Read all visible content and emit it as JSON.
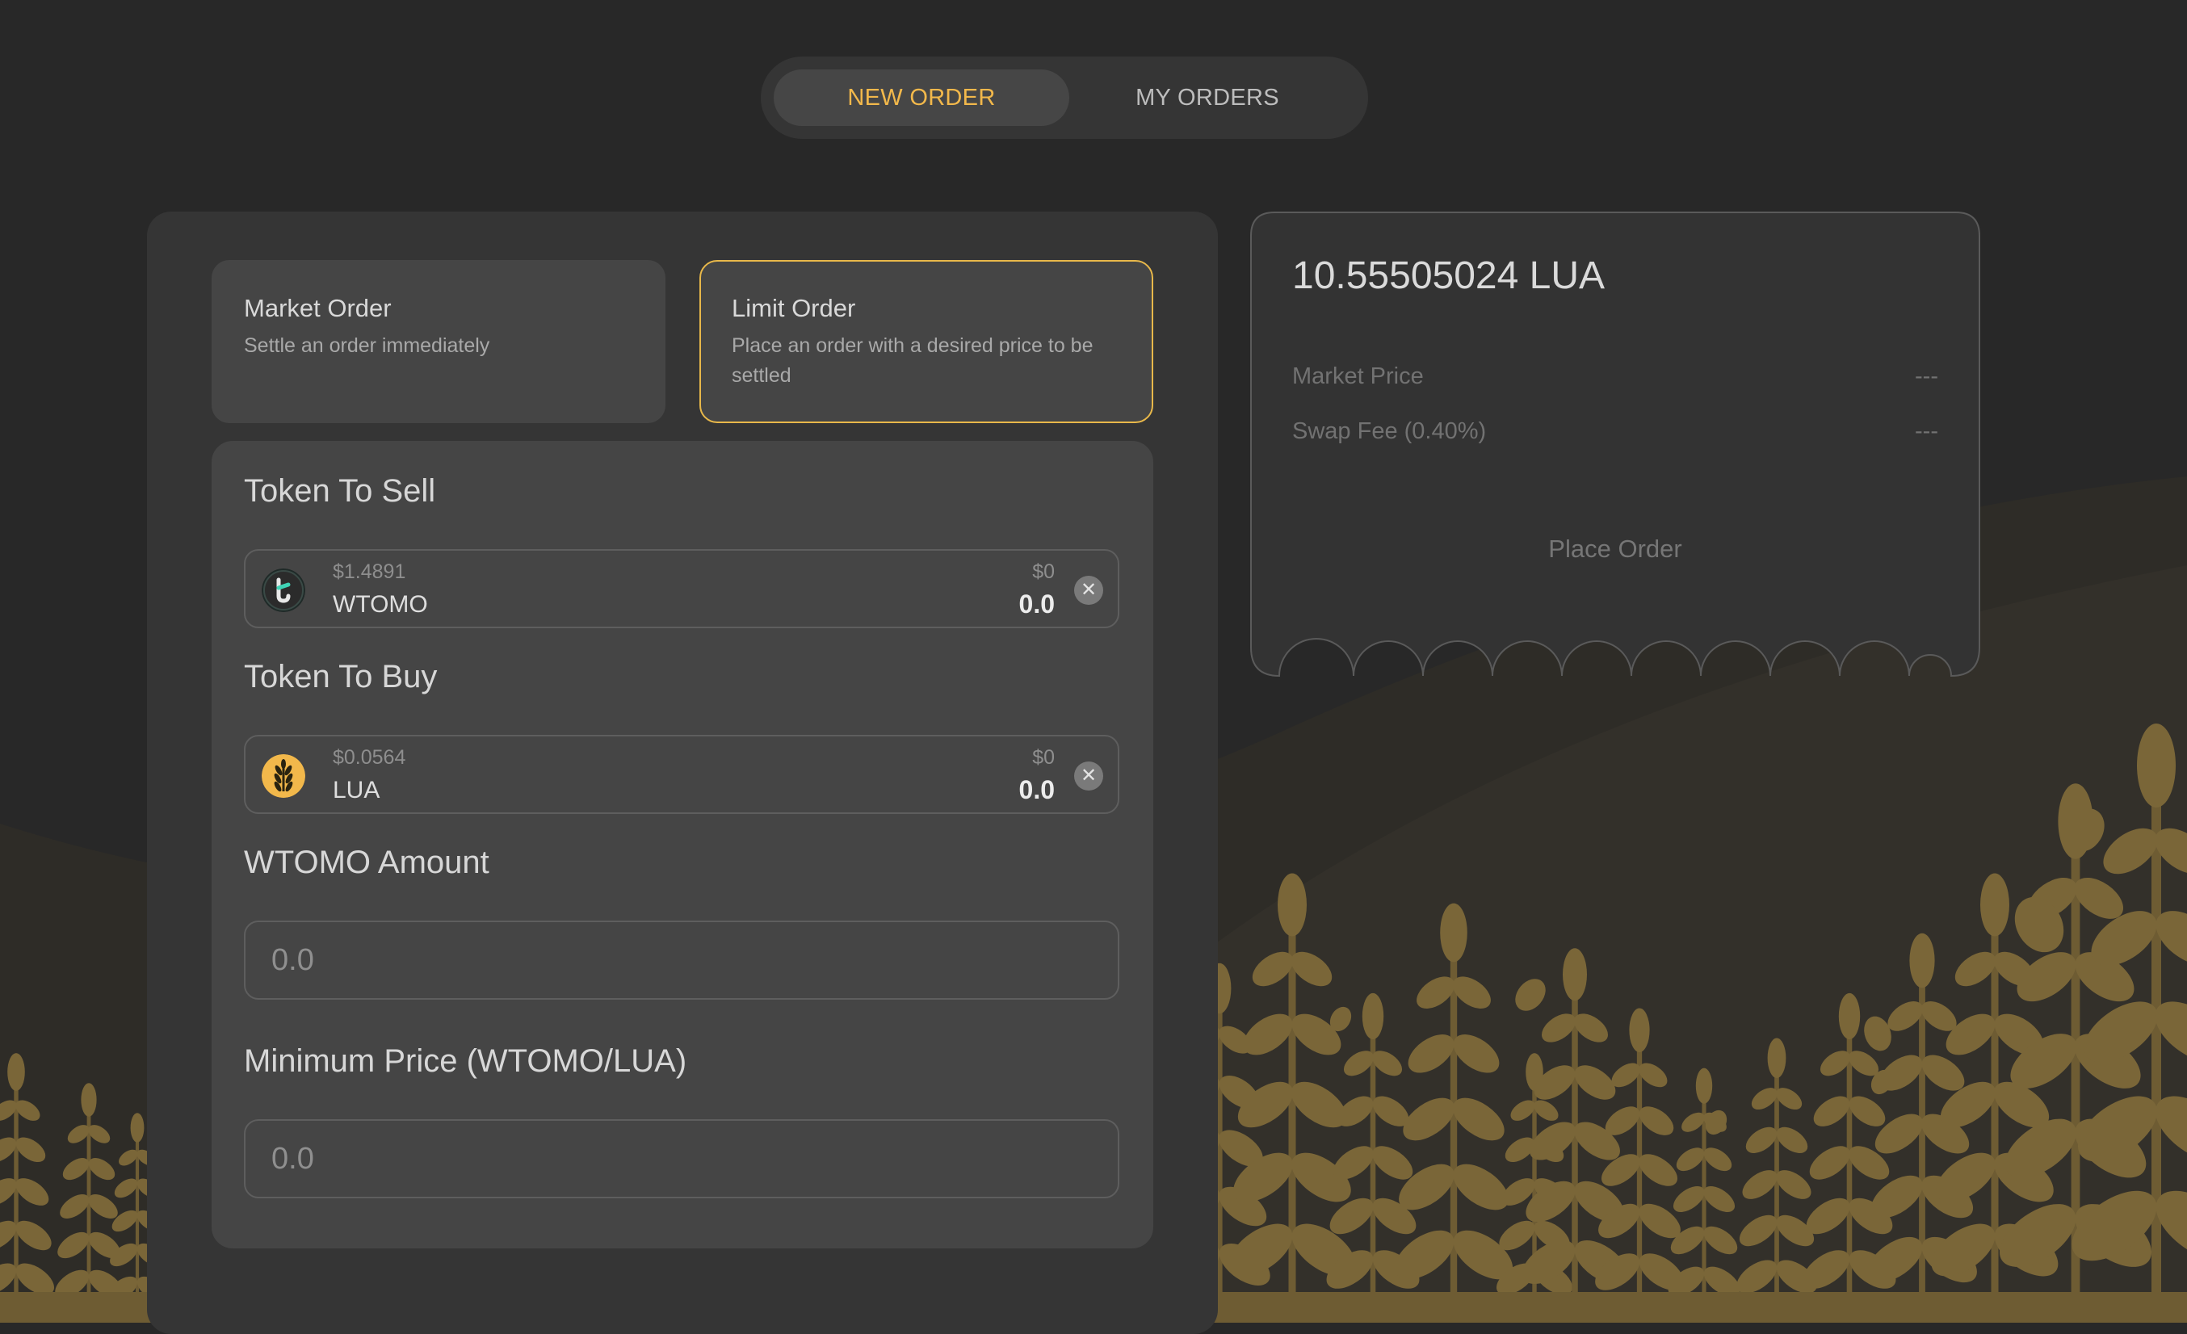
{
  "tabs": {
    "new_order": "NEW ORDER",
    "my_orders": "MY ORDERS"
  },
  "order_types": {
    "market": {
      "title": "Market Order",
      "desc": "Settle an order immediately"
    },
    "limit": {
      "title": "Limit Order",
      "desc": "Place an order with a desired price to be settled"
    },
    "selected": "limit"
  },
  "sell": {
    "label": "Token To Sell",
    "price": "$1.4891",
    "symbol": "WTOMO",
    "usd_value": "$0",
    "amount": "0.0",
    "icon": "tomo-logo-icon"
  },
  "buy": {
    "label": "Token To Buy",
    "price": "$0.0564",
    "symbol": "LUA",
    "usd_value": "$0",
    "amount": "0.0",
    "icon": "lua-wheat-logo-icon"
  },
  "amount_field": {
    "label": "WTOMO Amount",
    "placeholder": "0.0"
  },
  "min_price_field": {
    "label": "Minimum Price (WTOMO/LUA)",
    "placeholder": "0.0"
  },
  "summary": {
    "total": "10.55505024 LUA",
    "market_price_label": "Market Price",
    "market_price_value": "---",
    "swap_fee_label": "Swap Fee (0.40%)",
    "swap_fee_value": "---",
    "place_order": "Place Order"
  },
  "colors": {
    "accent": "#f2b84b",
    "background": "#282828",
    "panel": "#353535",
    "inner": "#454545",
    "wheat": "#7a6638"
  }
}
